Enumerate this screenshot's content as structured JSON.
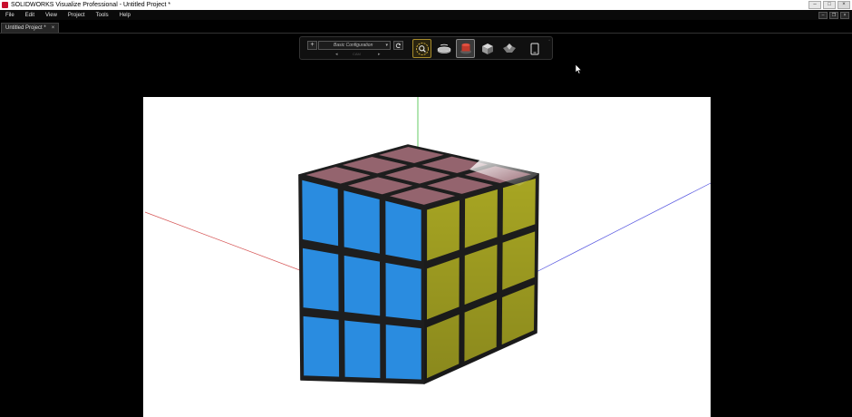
{
  "window": {
    "title": "SOLIDWORKS Visualize Professional - Untitled Project *",
    "app_icon": "solidworks-visualize-icon",
    "controls": [
      "minimize-icon",
      "maximize-icon",
      "close-icon"
    ]
  },
  "menu": {
    "items": [
      "File",
      "Edit",
      "View",
      "Project",
      "Tools",
      "Help"
    ]
  },
  "tabs": [
    {
      "label": "Untitled Project *",
      "close": "×"
    }
  ],
  "toolbar": {
    "add_label": "+",
    "configuration": "Basic Configuration",
    "refresh_icon": "refresh-icon",
    "camera_label": "CAM",
    "prev": "◂",
    "next": "▸",
    "tools": [
      {
        "name": "zoom-tool-icon",
        "state": "active"
      },
      {
        "name": "turntable-tool-icon",
        "state": "normal"
      },
      {
        "name": "object-tool-icon",
        "state": "selected"
      },
      {
        "name": "part-tool-icon",
        "state": "normal"
      },
      {
        "name": "floor-tool-icon",
        "state": "normal"
      },
      {
        "name": "tablet-mode-icon",
        "state": "normal"
      }
    ]
  },
  "scene": {
    "background": "#ffffff",
    "object": "3x3 cube",
    "face_colors": {
      "top": "#94646e",
      "front": "#2a8ce0",
      "right": "#a8a623"
    },
    "axis_colors": {
      "x": "#d65555",
      "y": "#3fbf3f",
      "z": "#5555e0"
    }
  }
}
